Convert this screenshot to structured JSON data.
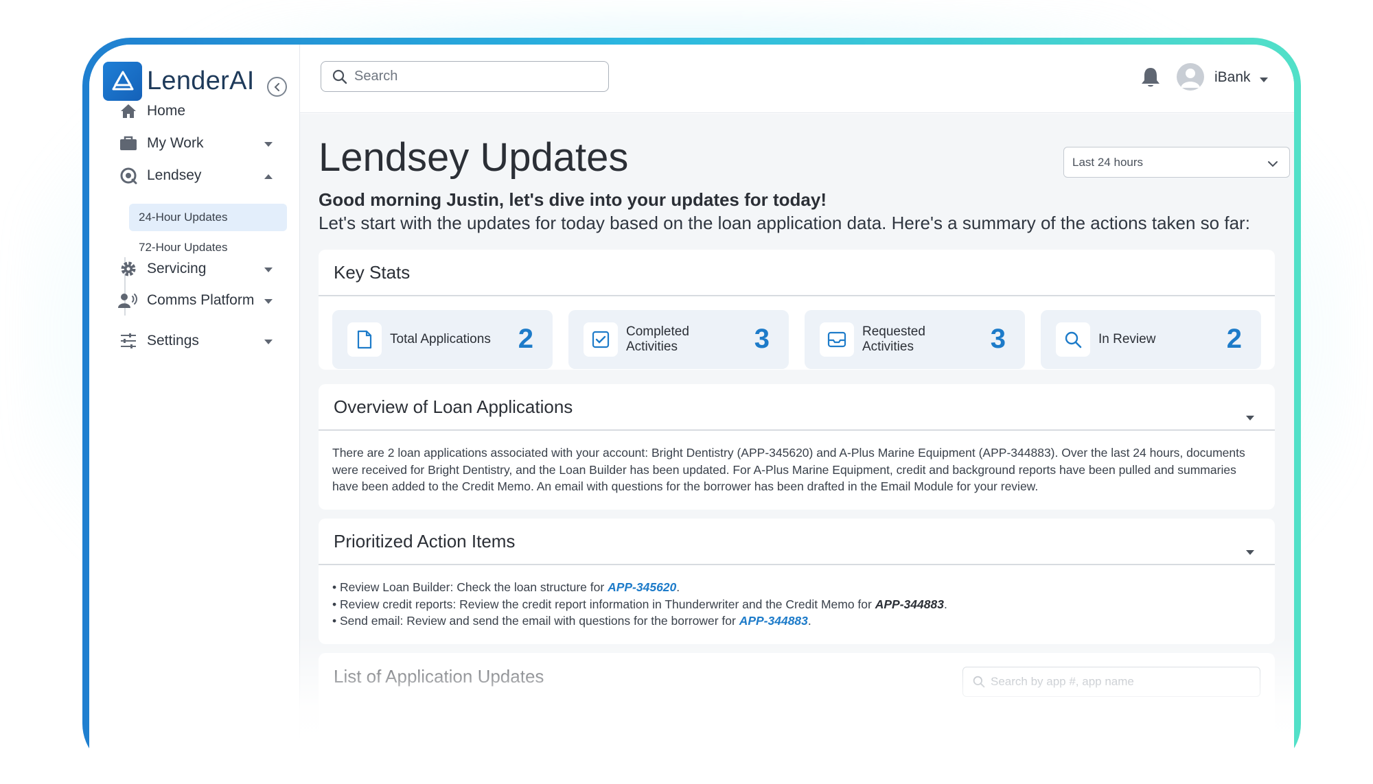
{
  "brand": {
    "name": "LenderAI"
  },
  "sidebar": {
    "items": [
      {
        "label": "Home"
      },
      {
        "label": "My Work"
      },
      {
        "label": "Lendsey"
      },
      {
        "label": "Servicing"
      },
      {
        "label": "Comms Platform"
      },
      {
        "label": "Settings"
      }
    ],
    "lendsey_sub": [
      {
        "label": "24-Hour Updates",
        "active": true
      },
      {
        "label": "72-Hour Updates",
        "active": false
      }
    ]
  },
  "topbar": {
    "search_placeholder": "Search",
    "user_name": "iBank"
  },
  "page": {
    "title": "Lendsey Updates",
    "range_value": "Last 24 hours",
    "greeting": "Good morning Justin, let's dive into your updates for today!",
    "summary": "Let's start with the updates for today based on the loan application data. Here's a summary of the actions taken so far:"
  },
  "key_stats": {
    "title": "Key Stats",
    "stats": [
      {
        "label": "Total Applications",
        "value": "2",
        "icon": "document-icon"
      },
      {
        "label": "Completed Activities",
        "value": "3",
        "icon": "checkbox-icon"
      },
      {
        "label": "Requested Activities",
        "value": "3",
        "icon": "inbox-icon"
      },
      {
        "label": "In Review",
        "value": "2",
        "icon": "search-icon"
      }
    ]
  },
  "overview": {
    "title": "Overview of Loan Applications",
    "text": "There are 2 loan applications associated with your account: Bright Dentistry (APP-345620) and A-Plus Marine Equipment (APP-344883). Over the last 24 hours, documents were received for Bright Dentistry, and the Loan Builder has been updated. For A-Plus Marine Equipment, credit and background reports have been pulled and summaries have been added to the Credit Memo. An email with questions for the borrower has been drafted in the Email Module for your review."
  },
  "actions": {
    "title": "Prioritized Action Items",
    "items": [
      {
        "prefix": "• Review Loan Builder: Check the loan structure for ",
        "app": "APP-345620",
        "suffix": "."
      },
      {
        "prefix": "• Review credit reports: Review the credit report information in Thunderwriter and the Credit Memo for ",
        "app": "APP-344883",
        "suffix": "."
      },
      {
        "prefix": "• Send email: Review and send the email with questions for the borrower for ",
        "app": "APP-344883",
        "suffix": "."
      }
    ]
  },
  "app_list": {
    "title": "List of Application Updates",
    "search_placeholder": "Search by app #, app name"
  },
  "colors": {
    "accent": "#1d7bc9",
    "brand": "#1e7fd6",
    "active_bg": "#e3eefb"
  }
}
